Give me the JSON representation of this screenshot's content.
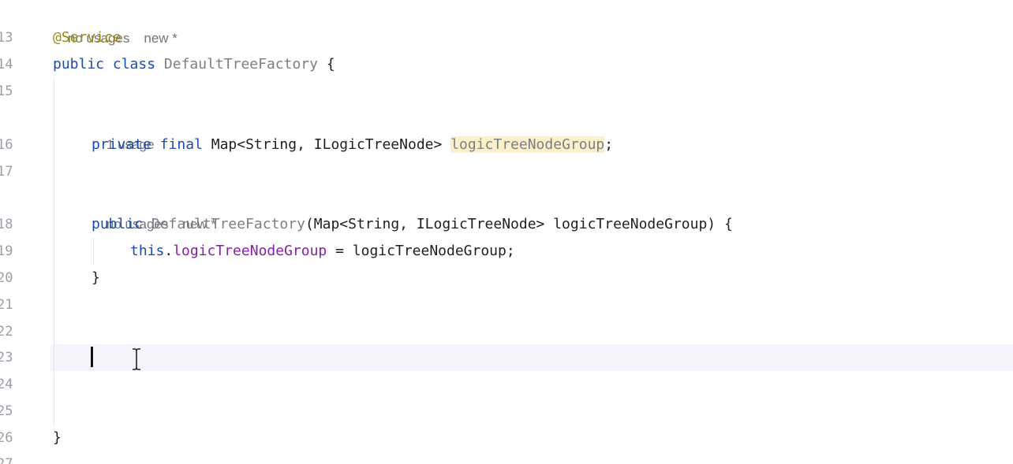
{
  "editor": {
    "line_numbers": [
      "13",
      "14",
      "15",
      "16",
      "17",
      "18",
      "19",
      "20",
      "21",
      "22",
      "23",
      "24",
      "25",
      "26",
      "27"
    ],
    "hints": {
      "class_usages": "no usages",
      "class_new": "new *",
      "field_usages": "1 usage",
      "ctor_usages": "no usages",
      "ctor_new": "new *"
    },
    "lines": {
      "l13": {
        "annotation": "@Service"
      },
      "l14": {
        "kw1": "public",
        "kw2": "class",
        "cls": "DefaultTreeFactory",
        "rest": " {"
      },
      "l16": {
        "kw1": "private",
        "kw2": "final",
        "type": "Map<String, ILogicTreeNode>",
        "field": "logicTreeNodeGroup",
        "end": ";"
      },
      "l18": {
        "kw1": "public",
        "ctor": "DefaultTreeFactory",
        "params": "(Map<String, ILogicTreeNode> logicTreeNodeGroup) {"
      },
      "l19": {
        "kw": "this",
        "dot": ".",
        "field": "logicTreeNodeGroup",
        "rest": " = logicTreeNodeGroup;"
      },
      "l20": {
        "brace": "}"
      },
      "l26": {
        "brace": "}"
      }
    },
    "current_line": "23",
    "colors": {
      "keyword": "#1b4bb0",
      "annotation": "#9d8a10",
      "class_name": "#7c7f85",
      "field": "#8a1ea8",
      "highlight": "#fbf0c9",
      "current_line_bg": "#f3f5fb"
    }
  }
}
